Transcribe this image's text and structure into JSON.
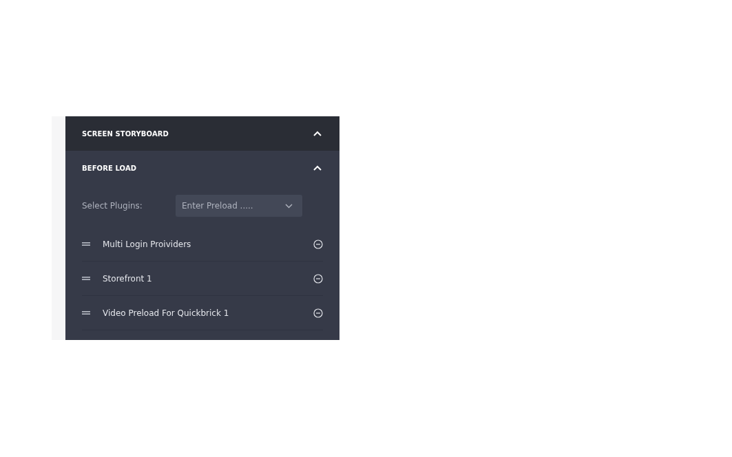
{
  "storyboard": {
    "title": "SCREEN STORYBOARD",
    "expanded": true
  },
  "before_load": {
    "title": "BEFORE LOAD",
    "expanded": true,
    "select": {
      "label": "Select Plugins:",
      "placeholder": "Enter Preload ....."
    },
    "plugins": [
      {
        "name": "Multi Login Proividers"
      },
      {
        "name": "Storefront 1"
      },
      {
        "name": "Video Preload For Quickbrick 1"
      }
    ]
  }
}
